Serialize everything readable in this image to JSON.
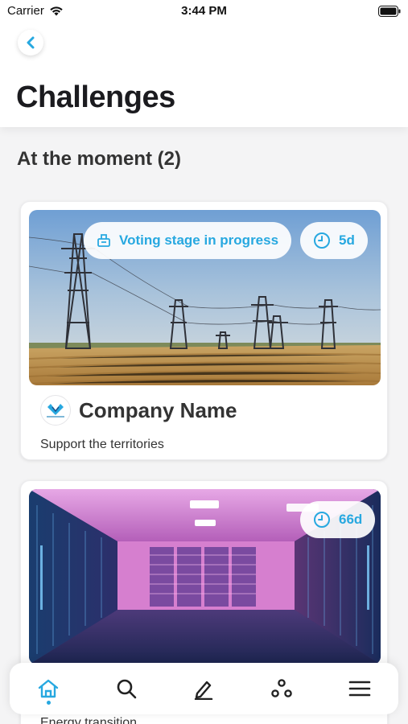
{
  "status_bar": {
    "carrier": "Carrier",
    "time": "3:44 PM"
  },
  "header": {
    "title": "Challenges"
  },
  "section": {
    "title": "At the moment (2)"
  },
  "challenges": [
    {
      "status_label": "Voting stage in progress",
      "time_left": "5d",
      "company_name": "Company Name",
      "subtitle": "Support the territories",
      "image": "power-lines-field"
    },
    {
      "time_left": "66d",
      "subtitle": "Energy transition",
      "image": "server-room"
    }
  ],
  "tabbar": {
    "items": [
      {
        "icon": "home-icon",
        "active": true
      },
      {
        "icon": "search-icon",
        "active": false
      },
      {
        "icon": "edit-icon",
        "active": false
      },
      {
        "icon": "community-icon",
        "active": false
      },
      {
        "icon": "menu-icon",
        "active": false
      }
    ]
  },
  "colors": {
    "accent": "#27a8e0",
    "background": "#f4f4f5",
    "text": "#2b2b2f"
  }
}
